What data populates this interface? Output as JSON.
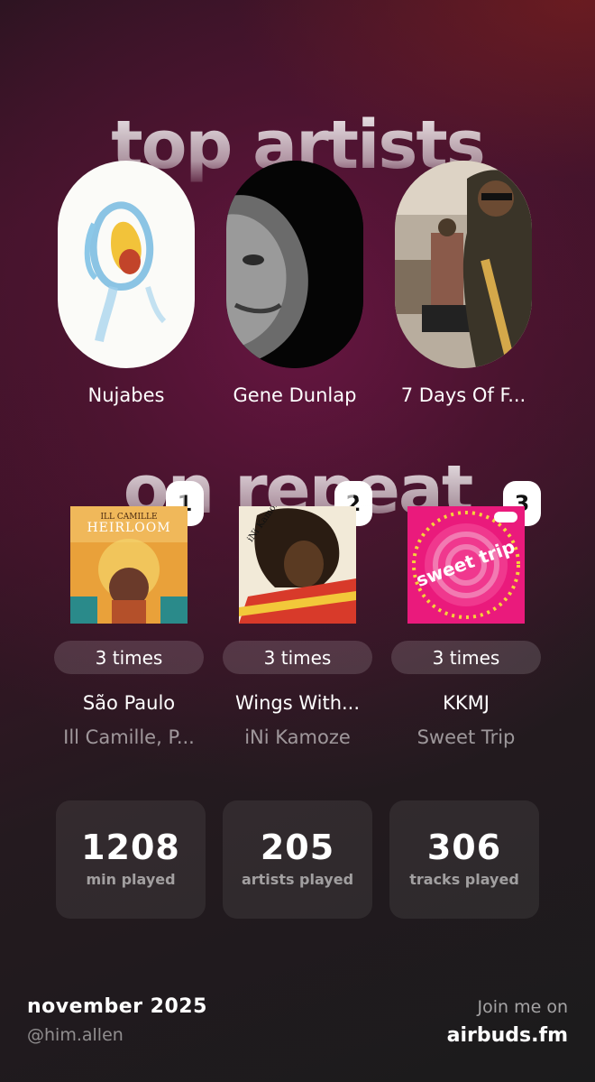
{
  "sections": {
    "top_artists_title": "top artists",
    "on_repeat_title": "on repeat"
  },
  "artists": [
    {
      "rank": "1",
      "name": "Nujabes",
      "image": "watercolor-flame-art"
    },
    {
      "rank": "2",
      "name": "Gene Dunlap",
      "image": "bw-portrait"
    },
    {
      "rank": "3",
      "name": "7 Days Of F...",
      "image": "studio-photo"
    }
  ],
  "tracks": [
    {
      "times": "3 times",
      "title": "São Paulo",
      "artist": "Ill Camille, P...",
      "cover_text_top": "ILL CAMILLE",
      "cover_text_main": "HEIRLOOM"
    },
    {
      "times": "3 times",
      "title": "Wings With...",
      "artist": "iNi Kamoze",
      "cover_text_top": "iNi Kamoze"
    },
    {
      "times": "3 times",
      "title": "KKMJ",
      "artist": "Sweet Trip",
      "cover_text_top": "sweet trip"
    }
  ],
  "stats": [
    {
      "value": "1208",
      "label": "min played"
    },
    {
      "value": "205",
      "label": "artists played"
    },
    {
      "value": "306",
      "label": "tracks played"
    }
  ],
  "footer": {
    "month": "november 2025",
    "handle": "@him.allen",
    "join": "Join me on",
    "site": "airbuds.fm"
  },
  "colors": {
    "accent_bg": "#3d1428",
    "card_bg": "#2a2a2b",
    "white": "#ffffff"
  }
}
